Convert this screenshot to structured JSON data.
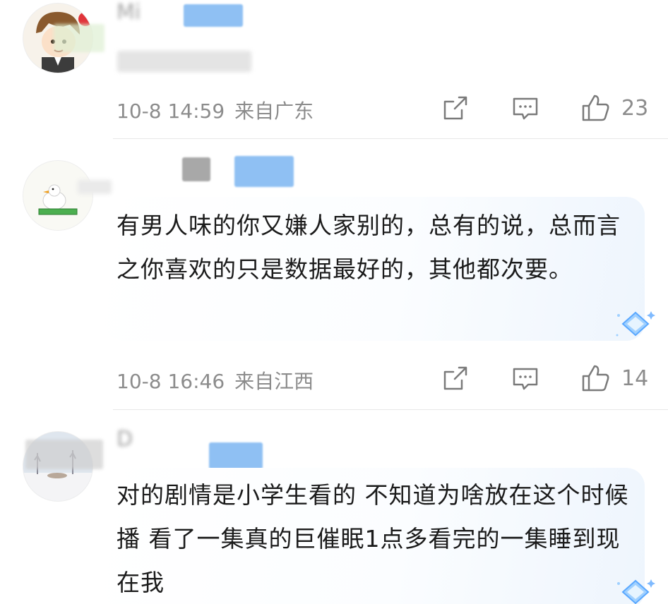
{
  "comments": [
    {
      "username": "Mi",
      "text": "",
      "time": "10-8 14:59",
      "location": "来自广东",
      "likes": "23"
    },
    {
      "username": "",
      "text": "有男人味的你又嫌人家别的，总有的说，总而言之你喜欢的只是数据最好的，其他都次要。",
      "time": "10-8 16:46",
      "location": "来自江西",
      "likes": "14"
    },
    {
      "username": "D",
      "text": "对的剧情是小学生看的 不知道为啥放在这个时候播 看了一集真的巨催眠1点多看完的一集睡到现在我",
      "time": "",
      "location": "",
      "likes": ""
    }
  ],
  "icons": {
    "share": "share-icon",
    "comment": "comment-icon",
    "like": "thumbs-up-icon"
  },
  "colors": {
    "meta_text": "#8c8c8c",
    "body_text": "#1b1b1b",
    "blur_blue": "#8fc0f3"
  }
}
